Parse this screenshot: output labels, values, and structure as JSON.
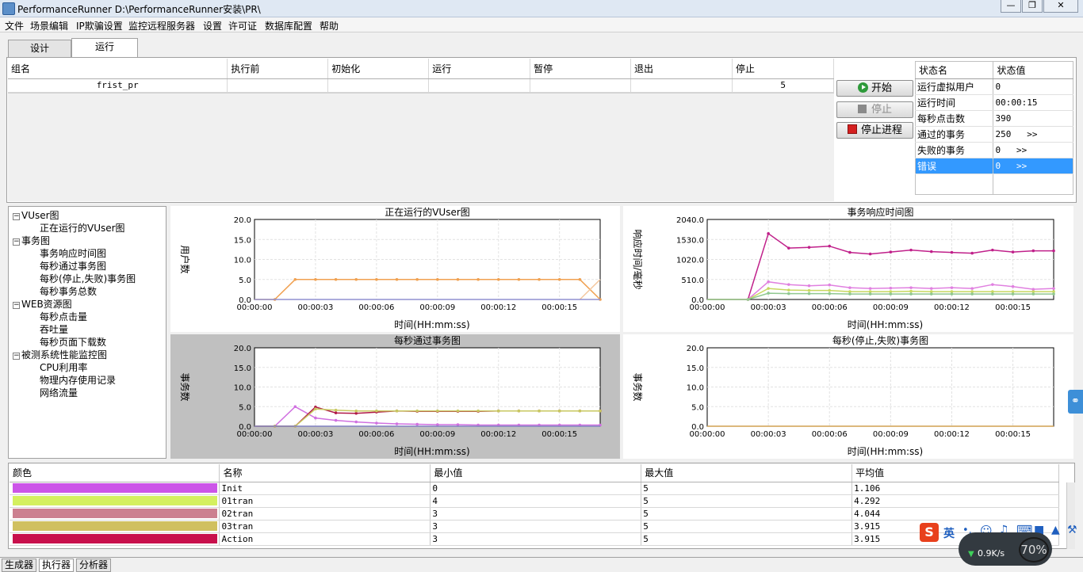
{
  "window": {
    "title": "PerformanceRunner  D:\\PerformanceRunner安装\\PR\\"
  },
  "menu": [
    "文件",
    "场景编辑",
    "IP欺骗设置",
    "监控远程服务器",
    "设置",
    "许可证",
    "数据库配置",
    "帮助"
  ],
  "tabs": [
    "设计",
    "运行"
  ],
  "group_table": {
    "headers": [
      "组名",
      "执行前",
      "初始化",
      "运行",
      "暂停",
      "退出",
      "停止"
    ],
    "rows": [
      [
        "frist_pr",
        "",
        "",
        "",
        "",
        "",
        "5"
      ]
    ]
  },
  "controls": {
    "start": "开始",
    "stop": "停止",
    "kill": "停止进程"
  },
  "status": {
    "headers": [
      "状态名",
      "状态值"
    ],
    "rows": [
      {
        "name": "运行虚拟用户",
        "value": "0",
        "more": ""
      },
      {
        "name": "运行时间",
        "value": "00:00:15",
        "more": ""
      },
      {
        "name": "每秒点击数",
        "value": "390",
        "more": ""
      },
      {
        "name": "通过的事务",
        "value": "250",
        "more": ">>"
      },
      {
        "name": "失败的事务",
        "value": "0",
        "more": ">>"
      },
      {
        "name": "错误",
        "value": "0",
        "more": ">>"
      }
    ]
  },
  "tree": [
    {
      "label": "VUser图",
      "level": 0
    },
    {
      "label": "正在运行的VUser图",
      "level": 1
    },
    {
      "label": "事务图",
      "level": 0
    },
    {
      "label": "事务响应时间图",
      "level": 1
    },
    {
      "label": "每秒通过事务图",
      "level": 1
    },
    {
      "label": "每秒(停止,失败)事务图",
      "level": 1
    },
    {
      "label": "每秒事务总数",
      "level": 1
    },
    {
      "label": "WEB资源图",
      "level": 0
    },
    {
      "label": "每秒点击量",
      "level": 1
    },
    {
      "label": "吞吐量",
      "level": 1
    },
    {
      "label": "每秒页面下载数",
      "level": 1
    },
    {
      "label": "被测系统性能监控图",
      "level": 0
    },
    {
      "label": "CPU利用率",
      "level": 1
    },
    {
      "label": "物理内存使用记录",
      "level": 1
    },
    {
      "label": "网络流量",
      "level": 1
    }
  ],
  "chart_data": [
    {
      "type": "line",
      "title": "正在运行的VUser图",
      "xlabel": "时间(HH:mm:ss)",
      "ylabel": "用户数",
      "yticks": [
        "20.0",
        "15.0",
        "10.0",
        "5.0",
        "0.0"
      ],
      "xticks": [
        "00:00:00",
        "00:00:03",
        "00:00:06",
        "00:00:09",
        "00:00:12",
        "00:00:15"
      ],
      "ylim": [
        0,
        20
      ],
      "xlim": [
        0,
        17
      ],
      "grid": true,
      "series": [
        {
          "color": "#f0a050",
          "x": [
            0,
            1,
            2,
            3,
            4,
            5,
            6,
            7,
            8,
            9,
            10,
            11,
            12,
            13,
            14,
            15,
            16,
            17
          ],
          "y": [
            0,
            0,
            5,
            5,
            5,
            5,
            5,
            5,
            5,
            5,
            5,
            5,
            5,
            5,
            5,
            5,
            5,
            0
          ]
        },
        {
          "color": "#f4c8a0",
          "x": [
            16,
            17
          ],
          "y": [
            0,
            5
          ]
        },
        {
          "color": "#9090d0",
          "x": [
            0,
            17
          ],
          "y": [
            0,
            0
          ]
        }
      ]
    },
    {
      "type": "line",
      "title": "事务响应时间图",
      "xlabel": "时间(HH:mm:ss)",
      "ylabel": "响应时间/毫秒",
      "yticks": [
        "2040.0",
        "1530.0",
        "1020.0",
        "510.0",
        "0.0"
      ],
      "xticks": [
        "00:00:00",
        "00:00:03",
        "00:00:06",
        "00:00:09",
        "00:00:12",
        "00:00:15"
      ],
      "ylim": [
        0,
        2040
      ],
      "xlim": [
        0,
        17
      ],
      "grid": true,
      "series": [
        {
          "color": "#c0208a",
          "x": [
            0,
            2,
            3,
            4,
            5,
            6,
            7,
            8,
            9,
            10,
            11,
            12,
            13,
            14,
            15,
            16,
            17
          ],
          "y": [
            0,
            0,
            1680,
            1310,
            1330,
            1360,
            1200,
            1160,
            1210,
            1260,
            1220,
            1200,
            1180,
            1260,
            1210,
            1240,
            1240
          ]
        },
        {
          "color": "#e080e0",
          "x": [
            0,
            2,
            3,
            4,
            5,
            6,
            7,
            8,
            9,
            10,
            11,
            12,
            13,
            14,
            15,
            16,
            17
          ],
          "y": [
            0,
            0,
            450,
            380,
            350,
            370,
            300,
            280,
            290,
            300,
            280,
            300,
            280,
            380,
            330,
            260,
            280
          ]
        },
        {
          "color": "#c8d860",
          "x": [
            0,
            2,
            3,
            4,
            5,
            6,
            7,
            8,
            9,
            10,
            11,
            12,
            13,
            14,
            15,
            16,
            17
          ],
          "y": [
            0,
            0,
            280,
            240,
            230,
            230,
            200,
            200,
            200,
            210,
            200,
            200,
            200,
            200,
            200,
            200,
            200
          ]
        },
        {
          "color": "#90c890",
          "x": [
            0,
            2,
            3,
            4,
            5,
            6,
            7,
            8,
            9,
            10,
            11,
            12,
            13,
            14,
            15,
            16,
            17
          ],
          "y": [
            0,
            0,
            160,
            150,
            150,
            150,
            140,
            140,
            140,
            140,
            140,
            140,
            140,
            140,
            140,
            140,
            140
          ]
        }
      ]
    },
    {
      "type": "line",
      "title": "每秒通过事务图",
      "xlabel": "时间(HH:mm:ss)",
      "ylabel": "事务数",
      "yticks": [
        "20.0",
        "15.0",
        "10.0",
        "5.0",
        "0.0"
      ],
      "xticks": [
        "00:00:00",
        "00:00:03",
        "00:00:06",
        "00:00:09",
        "00:00:12",
        "00:00:15"
      ],
      "ylim": [
        0,
        20
      ],
      "xlim": [
        0,
        17
      ],
      "grid": true,
      "series": [
        {
          "color": "#d070e0",
          "x": [
            0,
            1,
            2,
            3,
            4,
            5,
            6,
            7,
            8,
            9,
            10,
            11,
            12,
            13,
            14,
            15,
            16,
            17
          ],
          "y": [
            0,
            0,
            5,
            2.1,
            1.5,
            1.1,
            0.8,
            0.6,
            0.5,
            0.4,
            0.4,
            0.3,
            0.3,
            0.3,
            0.3,
            0.3,
            0.3,
            0.3
          ]
        },
        {
          "color": "#b01848",
          "x": [
            0,
            1,
            2,
            3,
            4,
            5,
            6,
            7,
            8,
            9,
            10,
            11,
            12,
            13,
            14,
            15,
            16,
            17
          ],
          "y": [
            0,
            0,
            0,
            4.9,
            3.4,
            3.3,
            3.6,
            3.9,
            3.8,
            3.8,
            3.8,
            3.8,
            3.9,
            3.9,
            3.9,
            3.9,
            3.9,
            3.9
          ]
        },
        {
          "color": "#c8c860",
          "x": [
            0,
            1,
            2,
            3,
            4,
            5,
            6,
            7,
            8,
            9,
            10,
            11,
            12,
            13,
            14,
            15,
            16,
            17
          ],
          "y": [
            0,
            0,
            0,
            4.4,
            4.1,
            3.9,
            3.9,
            3.9,
            3.9,
            3.9,
            3.9,
            3.9,
            3.9,
            3.9,
            3.9,
            3.9,
            3.9,
            3.9
          ]
        },
        {
          "color": "#8080c0",
          "x": [
            0,
            17
          ],
          "y": [
            0,
            0
          ]
        }
      ]
    },
    {
      "type": "line",
      "title": "每秒(停止,失败)事务图",
      "xlabel": "时间(HH:mm:ss)",
      "ylabel": "事务数",
      "yticks": [
        "20.0",
        "15.0",
        "10.0",
        "5.0",
        "0.0"
      ],
      "xticks": [
        "00:00:00",
        "00:00:03",
        "00:00:06",
        "00:00:09",
        "00:00:12",
        "00:00:15"
      ],
      "ylim": [
        0,
        20
      ],
      "xlim": [
        0,
        17
      ],
      "grid": true,
      "series": [
        {
          "color": "#d0a050",
          "x": [
            0,
            17
          ],
          "y": [
            0,
            0
          ]
        }
      ]
    }
  ],
  "legend": {
    "headers": [
      "颜色",
      "名称",
      "最小值",
      "最大值",
      "平均值"
    ],
    "rows": [
      {
        "color": "#cc55e8",
        "name": "Init",
        "min": "0",
        "max": "5",
        "avg": "1.106"
      },
      {
        "color": "#d4f060",
        "name": "01tran",
        "min": "4",
        "max": "5",
        "avg": "4.292"
      },
      {
        "color": "#cc8090",
        "name": "02tran",
        "min": "3",
        "max": "5",
        "avg": "4.044"
      },
      {
        "color": "#d0c060",
        "name": "03tran",
        "min": "3",
        "max": "5",
        "avg": "3.915"
      },
      {
        "color": "#c8104c",
        "name": "Action",
        "min": "3",
        "max": "5",
        "avg": "3.915"
      }
    ]
  },
  "bottom_tabs": [
    "生成器",
    "执行器",
    "分析器"
  ],
  "tray": {
    "ime_label": "英",
    "net_speed": "0.9K/s",
    "percent": "70%"
  }
}
